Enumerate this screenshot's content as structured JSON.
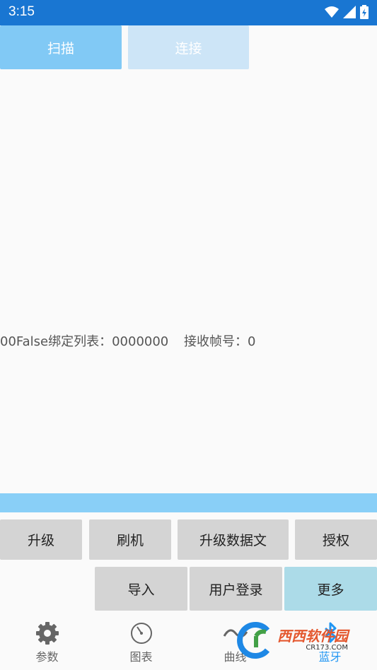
{
  "status_bar": {
    "time": "3:15"
  },
  "actions": {
    "scan": "扫描",
    "connect": "连接"
  },
  "info": {
    "bind_list": "00False绑定列表：0000000",
    "frame_no": "接收帧号：0"
  },
  "buttons": {
    "upgrade": "升级",
    "flash": "刷机",
    "upgrade_data": "升级数据文",
    "authorize": "授权",
    "import": "导入",
    "user_login": "用户登录",
    "more": "更多"
  },
  "nav": [
    {
      "label": "参数",
      "icon": "gear-icon"
    },
    {
      "label": "图表",
      "icon": "gauge-icon"
    },
    {
      "label": "曲线",
      "icon": "wave-icon"
    },
    {
      "label": "蓝牙",
      "icon": "bluetooth-icon",
      "active": true
    }
  ],
  "watermark": {
    "brand": "西西软件园",
    "site": "CR173.COM"
  },
  "colors": {
    "status_bar": "#1976d2",
    "accent_blue": "#2196f3",
    "more_button": "#acdbe8"
  }
}
